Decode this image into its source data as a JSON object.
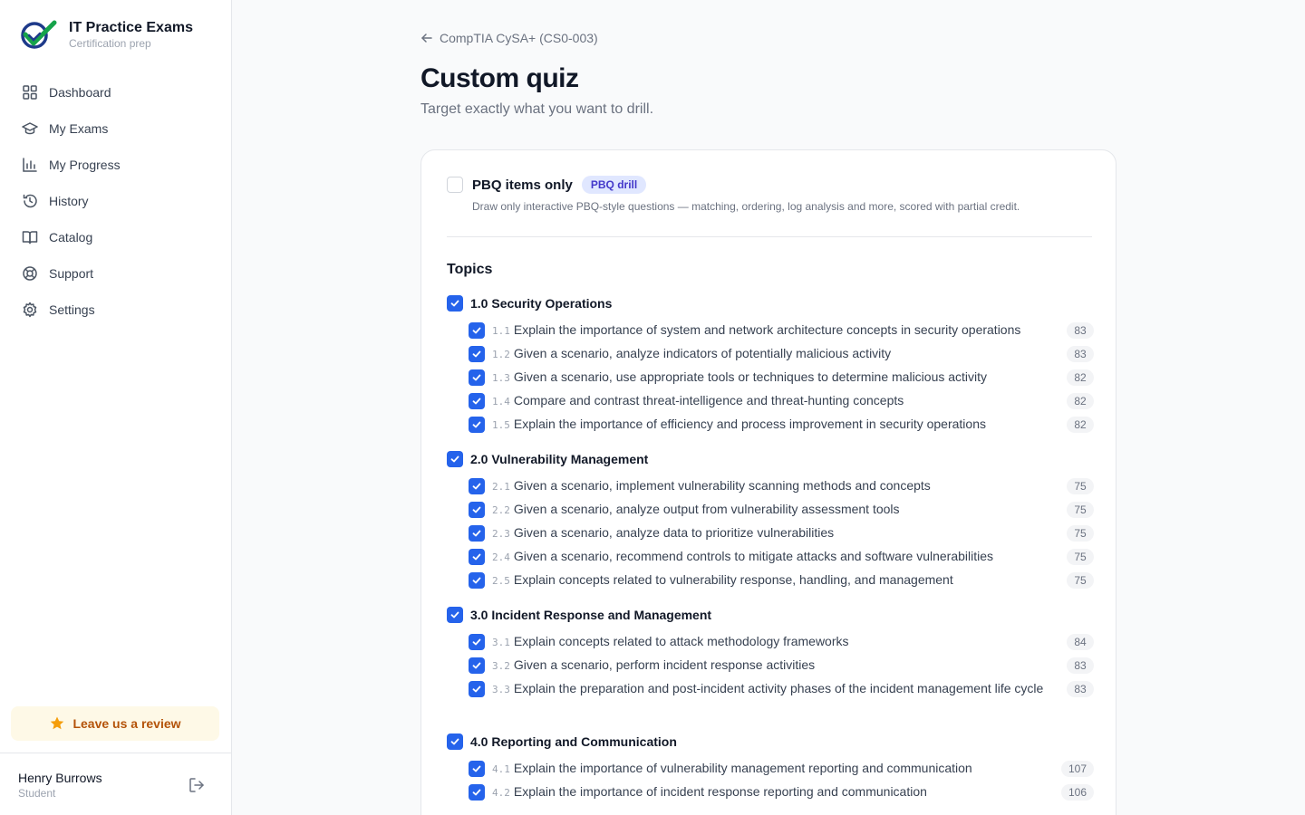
{
  "brand": {
    "name": "IT Practice Exams",
    "subtitle": "Certification prep"
  },
  "nav": [
    {
      "label": "Dashboard",
      "icon": "grid-icon"
    },
    {
      "label": "My Exams",
      "icon": "graduation-cap-icon"
    },
    {
      "label": "My Progress",
      "icon": "bar-chart-icon"
    },
    {
      "label": "History",
      "icon": "history-icon"
    },
    {
      "label": "Catalog",
      "icon": "book-icon"
    },
    {
      "label": "Support",
      "icon": "lifebuoy-icon"
    },
    {
      "label": "Settings",
      "icon": "gear-icon"
    }
  ],
  "review": {
    "label": "Leave us a review",
    "icon": "star-icon"
  },
  "user": {
    "name": "Henry Burrows",
    "role": "Student"
  },
  "breadcrumb": {
    "label": "CompTIA CySA+ (CS0-003)"
  },
  "page": {
    "title": "Custom quiz",
    "subtitle": "Target exactly what you want to drill."
  },
  "pbq": {
    "label": "PBQ items only",
    "badge": "PBQ drill",
    "checked": false,
    "description": "Draw only interactive PBQ-style questions — matching, ordering, log analysis and more, scored with partial credit."
  },
  "topics": {
    "heading": "Topics",
    "domains": [
      {
        "label": "1.0 Security Operations",
        "checked": true,
        "objectives": [
          {
            "num": "1.1",
            "text": "Explain the importance of system and network architecture concepts in security operations",
            "count": "83"
          },
          {
            "num": "1.2",
            "text": "Given a scenario, analyze indicators of potentially malicious activity",
            "count": "83"
          },
          {
            "num": "1.3",
            "text": "Given a scenario, use appropriate tools or techniques to determine malicious activity",
            "count": "82"
          },
          {
            "num": "1.4",
            "text": "Compare and contrast threat-intelligence and threat-hunting concepts",
            "count": "82"
          },
          {
            "num": "1.5",
            "text": "Explain the importance of efficiency and process improvement in security operations",
            "count": "82"
          }
        ]
      },
      {
        "label": "2.0 Vulnerability Management",
        "checked": true,
        "objectives": [
          {
            "num": "2.1",
            "text": "Given a scenario, implement vulnerability scanning methods and concepts",
            "count": "75"
          },
          {
            "num": "2.2",
            "text": "Given a scenario, analyze output from vulnerability assessment tools",
            "count": "75"
          },
          {
            "num": "2.3",
            "text": "Given a scenario, analyze data to prioritize vulnerabilities",
            "count": "75"
          },
          {
            "num": "2.4",
            "text": "Given a scenario, recommend controls to mitigate attacks and software vulnerabilities",
            "count": "75"
          },
          {
            "num": "2.5",
            "text": "Explain concepts related to vulnerability response, handling, and management",
            "count": "75"
          }
        ]
      },
      {
        "label": "3.0 Incident Response and Management",
        "checked": true,
        "objectives": [
          {
            "num": "3.1",
            "text": "Explain concepts related to attack methodology frameworks",
            "count": "84"
          },
          {
            "num": "3.2",
            "text": "Given a scenario, perform incident response activities",
            "count": "83"
          },
          {
            "num": "3.3",
            "text": "Explain the preparation and post-incident activity phases of the incident management life cycle",
            "count": "83"
          }
        ]
      },
      {
        "label": "4.0 Reporting and Communication",
        "checked": true,
        "objectives": [
          {
            "num": "4.1",
            "text": "Explain the importance of vulnerability management reporting and communication",
            "count": "107"
          },
          {
            "num": "4.2",
            "text": "Explain the importance of incident response reporting and communication",
            "count": "106"
          }
        ]
      }
    ]
  },
  "colors": {
    "accent": "#2563eb",
    "badge_bg": "#e0e7ff",
    "badge_text": "#4338ca",
    "review_bg": "#fef9e7",
    "review_text": "#b45309"
  }
}
